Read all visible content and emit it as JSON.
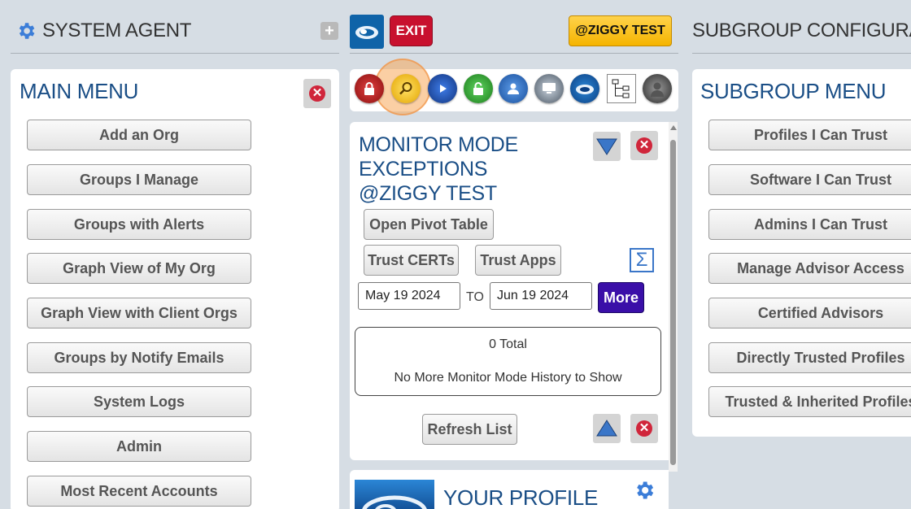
{
  "left_header": {
    "title": "SYSTEM AGENT"
  },
  "center_header": {
    "exit_label": "EXIT",
    "org_label": "@ZIGGY TEST"
  },
  "right_header": {
    "title": "SUBGROUP CONFIGURATIO"
  },
  "main_menu": {
    "title": "MAIN MENU",
    "items": [
      "Add an Org",
      "Groups I Manage",
      "Groups with Alerts",
      "Graph View of My Org",
      "Graph View with Client Orgs",
      "Groups by Notify Emails",
      "System Logs",
      "Admin",
      "Most Recent Accounts"
    ]
  },
  "toolbar": {
    "icons": [
      "lock-red-icon",
      "search-icon",
      "play-icon",
      "lock-green-icon",
      "users-icon",
      "monitor-icon",
      "cloud-icon",
      "org-chart-icon",
      "user-avatar-icon"
    ]
  },
  "monitor": {
    "title_line1": "MONITOR MODE",
    "title_line2": "EXCEPTIONS",
    "title_line3": "@ZIGGY TEST",
    "open_pivot_label": "Open Pivot Table",
    "trust_certs_label": "Trust CERTs",
    "trust_apps_label": "Trust Apps",
    "date_from": "May 19 2024",
    "to_label": "TO",
    "date_to": "Jun 19 2024",
    "more_label": "More",
    "total_text": "0 Total",
    "empty_text": "No More Monitor Mode History to Show",
    "refresh_label": "Refresh List"
  },
  "profile": {
    "title": "YOUR PROFILE"
  },
  "subgroup_menu": {
    "title": "SUBGROUP MENU",
    "items": [
      "Profiles I Can Trust",
      "Software I Can Trust",
      "Admins I Can Trust",
      "Manage Advisor Access",
      "Certified Advisors",
      "Directly Trusted Profiles",
      "Trusted & Inherited Profiles"
    ]
  },
  "colors": {
    "accent_blue": "#1a4e86",
    "exit_red": "#c8102e",
    "org_yellow": "#f5b400",
    "more_purple": "#3a0fa8",
    "background": "#d6dde4"
  }
}
